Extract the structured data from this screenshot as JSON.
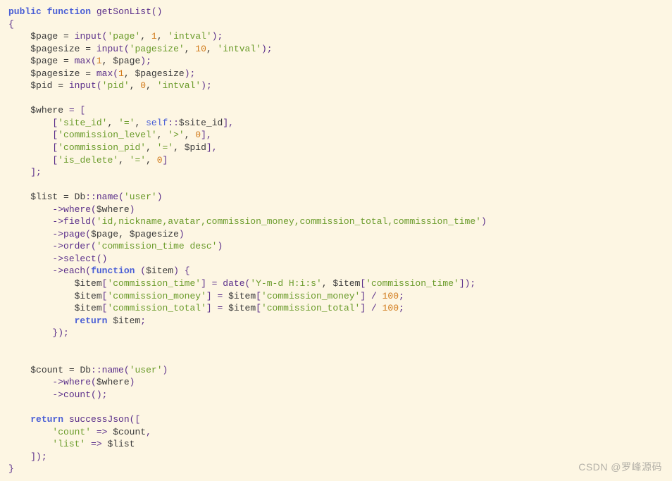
{
  "code": {
    "line01": {
      "kw1": "public",
      "kw2": "function",
      "name": "getSonList",
      "paren": "()"
    },
    "line02": "{",
    "line03": {
      "v1": "$page",
      "eq": " = ",
      "fn": "input",
      "p1": "(",
      "s1": "'page'",
      "c1": ", ",
      "n1": "1",
      "c2": ", ",
      "s2": "'intval'",
      "p2": ");"
    },
    "line04": {
      "v1": "$pagesize",
      "eq": " = ",
      "fn": "input",
      "p1": "(",
      "s1": "'pagesize'",
      "c1": ", ",
      "n1": "10",
      "c2": ", ",
      "s2": "'intval'",
      "p2": ");"
    },
    "line05": {
      "v1": "$page",
      "eq": " = ",
      "fn": "max",
      "p1": "(",
      "n1": "1",
      "c1": ", ",
      "v2": "$page",
      "p2": ");"
    },
    "line06": {
      "v1": "$pagesize",
      "eq": " = ",
      "fn": "max",
      "p1": "(",
      "n1": "1",
      "c1": ", ",
      "v2": "$pagesize",
      "p2": ");"
    },
    "line07": {
      "v1": "$pid",
      "eq": " = ",
      "fn": "input",
      "p1": "(",
      "s1": "'pid'",
      "c1": ", ",
      "n1": "0",
      "c2": ", ",
      "s2": "'intval'",
      "p2": ");"
    },
    "line09": {
      "v1": "$where",
      "eq": " = ["
    },
    "line10": {
      "p1": "[",
      "s1": "'site_id'",
      "c1": ", ",
      "s2": "'='",
      "c2": ", ",
      "self": "self",
      "dcol": "::",
      "v2": "$site_id",
      "p2": "],"
    },
    "line11": {
      "p1": "[",
      "s1": "'commission_level'",
      "c1": ", ",
      "s2": "'>'",
      "c2": ", ",
      "n1": "0",
      "p2": "],"
    },
    "line12": {
      "p1": "[",
      "s1": "'commission_pid'",
      "c1": ", ",
      "s2": "'='",
      "c2": ", ",
      "v2": "$pid",
      "p2": "],"
    },
    "line13": {
      "p1": "[",
      "s1": "'is_delete'",
      "c1": ", ",
      "s2": "'='",
      "c2": ", ",
      "n1": "0",
      "p2": "]"
    },
    "line14": "];",
    "line16": {
      "v1": "$list",
      "eq": " = ",
      "cls": "Db",
      "dcol": "::",
      "fn": "name",
      "p1": "(",
      "s1": "'user'",
      "p2": ")"
    },
    "line17": {
      "arrow": "->",
      "fn": "where",
      "p1": "(",
      "v1": "$where",
      "p2": ")"
    },
    "line18": {
      "arrow": "->",
      "fn": "field",
      "p1": "(",
      "s1": "'id,nickname,avatar,commission_money,commission_total,commission_time'",
      "p2": ")"
    },
    "line19": {
      "arrow": "->",
      "fn": "page",
      "p1": "(",
      "v1": "$page",
      "c1": ", ",
      "v2": "$pagesize",
      "p2": ")"
    },
    "line20": {
      "arrow": "->",
      "fn": "order",
      "p1": "(",
      "s1": "'commission_time desc'",
      "p2": ")"
    },
    "line21": {
      "arrow": "->",
      "fn": "select",
      "p1": "()"
    },
    "line22": {
      "arrow": "->",
      "fn": "each",
      "p1": "(",
      "kw": "function",
      "sp": " (",
      "v1": "$item",
      "p2": ") {"
    },
    "line23": {
      "v1": "$item",
      "p1": "[",
      "s1": "'commission_time'",
      "p2": "] = ",
      "fn": "date",
      "p3": "(",
      "s2": "'Y-m-d H:i:s'",
      "c1": ", ",
      "v2": "$item",
      "p4": "[",
      "s3": "'commission_time'",
      "p5": "]);"
    },
    "line24": {
      "v1": "$item",
      "p1": "[",
      "s1": "'commission_money'",
      "p2": "] = ",
      "v2": "$item",
      "p3": "[",
      "s2": "'commission_money'",
      "p4": "] / ",
      "n1": "100",
      "p5": ";"
    },
    "line25": {
      "v1": "$item",
      "p1": "[",
      "s1": "'commission_total'",
      "p2": "] = ",
      "v2": "$item",
      "p3": "[",
      "s2": "'commission_total'",
      "p4": "] / ",
      "n1": "100",
      "p5": ";"
    },
    "line26": {
      "kw": "return",
      "sp": " ",
      "v1": "$item",
      "p1": ";"
    },
    "line27": "});",
    "line30": {
      "v1": "$count",
      "eq": " = ",
      "cls": "Db",
      "dcol": "::",
      "fn": "name",
      "p1": "(",
      "s1": "'user'",
      "p2": ")"
    },
    "line31": {
      "arrow": "->",
      "fn": "where",
      "p1": "(",
      "v1": "$where",
      "p2": ")"
    },
    "line32": {
      "arrow": "->",
      "fn": "count",
      "p1": "();"
    },
    "line34": {
      "kw": "return",
      "sp": " ",
      "fn": "successJson",
      "p1": "(["
    },
    "line35": {
      "s1": "'count'",
      "arrow": " => ",
      "v1": "$count",
      "p1": ","
    },
    "line36": {
      "s1": "'list'",
      "arrow": " => ",
      "v1": "$list"
    },
    "line37": "]);",
    "line38": "}"
  },
  "watermark": "CSDN @罗峰源码"
}
